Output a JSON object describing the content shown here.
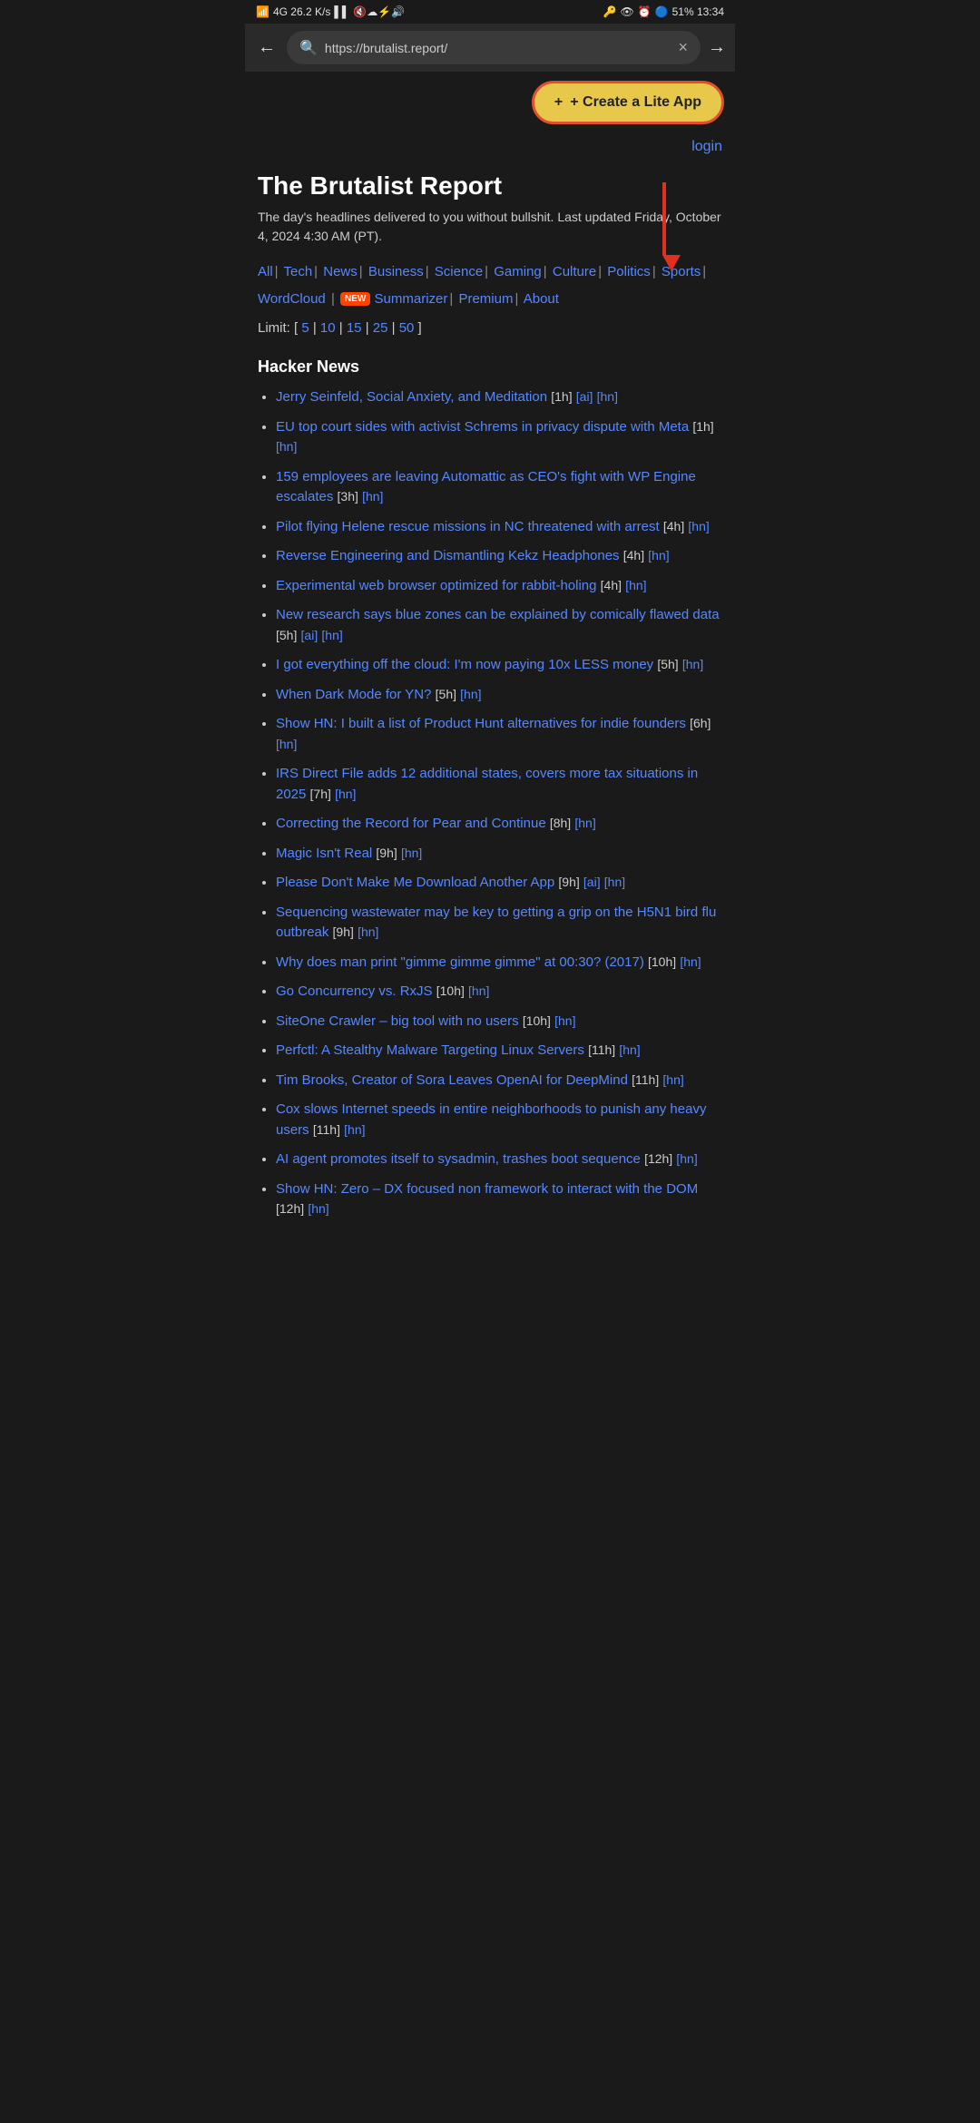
{
  "statusBar": {
    "left": "4G 26.2 K/s",
    "right": "51% 13:34"
  },
  "browser": {
    "url": "https://brutalist.report/",
    "backLabel": "←",
    "forwardLabel": "→",
    "clearLabel": "×"
  },
  "createAppBtn": {
    "label": "+ Create a Lite App"
  },
  "page": {
    "loginLabel": "login",
    "title": "The Brutalist Report",
    "tagline": "The day's headlines delivered to you without bullshit. Last updated Friday, October 4, 2024 4:30 AM (PT).",
    "nav": {
      "all": "All",
      "tech": "Tech",
      "news": "News",
      "business": "Business",
      "science": "Science",
      "gaming": "Gaming",
      "culture": "Culture",
      "politics": "Politics",
      "sports": "Sports",
      "wordcloud": "WordCloud",
      "summarizer": "Summarizer",
      "premium": "Premium",
      "about": "About"
    },
    "limit": {
      "label": "Limit: [",
      "options": [
        "5",
        "10",
        "15",
        "25",
        "50"
      ],
      "close": "]"
    },
    "sections": [
      {
        "title": "Hacker News",
        "items": [
          {
            "text": "Jerry Seinfeld, Social Anxiety, and Meditation",
            "meta": "[1h]",
            "tags": [
              "[ai]",
              "[hn]"
            ]
          },
          {
            "text": "EU top court sides with activist Schrems in privacy dispute with Meta",
            "meta": "[1h]",
            "tags": [
              "[hn]"
            ]
          },
          {
            "text": "159 employees are leaving Automattic as CEO's fight with WP Engine escalates",
            "meta": "[3h]",
            "tags": [
              "[hn]"
            ]
          },
          {
            "text": "Pilot flying Helene rescue missions in NC threatened with arrest",
            "meta": "[4h]",
            "tags": [
              "[hn]"
            ]
          },
          {
            "text": "Reverse Engineering and Dismantling Kekz Headphones",
            "meta": "[4h]",
            "tags": [
              "[hn]"
            ]
          },
          {
            "text": "Experimental web browser optimized for rabbit-holing",
            "meta": "[4h]",
            "tags": [
              "[hn]"
            ]
          },
          {
            "text": "New research says blue zones can be explained by comically flawed data",
            "meta": "[5h]",
            "tags": [
              "[ai]",
              "[hn]"
            ]
          },
          {
            "text": "I got everything off the cloud: I'm now paying 10x LESS money",
            "meta": "[5h]",
            "tags": [
              "[hn]"
            ]
          },
          {
            "text": "When Dark Mode for YN?",
            "meta": "[5h]",
            "tags": [
              "[hn]"
            ]
          },
          {
            "text": "Show HN: I built a list of Product Hunt alternatives for indie founders",
            "meta": "[6h]",
            "tags": [
              "[hn]"
            ]
          },
          {
            "text": "IRS Direct File adds 12 additional states, covers more tax situations in 2025",
            "meta": "[7h]",
            "tags": [
              "[hn]"
            ]
          },
          {
            "text": "Correcting the Record for Pear and Continue",
            "meta": "[8h]",
            "tags": [
              "[hn]"
            ]
          },
          {
            "text": "Magic Isn't Real",
            "meta": "[9h]",
            "tags": [
              "[hn]"
            ]
          },
          {
            "text": "Please Don't Make Me Download Another App",
            "meta": "[9h]",
            "tags": [
              "[ai]",
              "[hn]"
            ]
          },
          {
            "text": "Sequencing wastewater may be key to getting a grip on the H5N1 bird flu outbreak",
            "meta": "[9h]",
            "tags": [
              "[hn]"
            ]
          },
          {
            "text": "Why does man print \"gimme gimme gimme\" at 00:30? (2017)",
            "meta": "[10h]",
            "tags": [
              "[hn]"
            ]
          },
          {
            "text": "Go Concurrency vs. RxJS",
            "meta": "[10h]",
            "tags": [
              "[hn]"
            ]
          },
          {
            "text": "SiteOne Crawler – big tool with no users",
            "meta": "[10h]",
            "tags": [
              "[hn]"
            ]
          },
          {
            "text": "Perfctl: A Stealthy Malware Targeting Linux Servers",
            "meta": "[11h]",
            "tags": [
              "[hn]"
            ]
          },
          {
            "text": "Tim Brooks, Creator of Sora Leaves OpenAI for DeepMind",
            "meta": "[11h]",
            "tags": [
              "[hn]"
            ]
          },
          {
            "text": "Cox slows Internet speeds in entire neighborhoods to punish any heavy users",
            "meta": "[11h]",
            "tags": [
              "[hn]"
            ]
          },
          {
            "text": "AI agent promotes itself to sysadmin, trashes boot sequence",
            "meta": "[12h]",
            "tags": [
              "[hn]"
            ]
          },
          {
            "text": "Show HN: Zero – DX focused non framework to interact with the DOM",
            "meta": "[12h]",
            "tags": [
              "[hn]"
            ]
          }
        ]
      }
    ]
  }
}
